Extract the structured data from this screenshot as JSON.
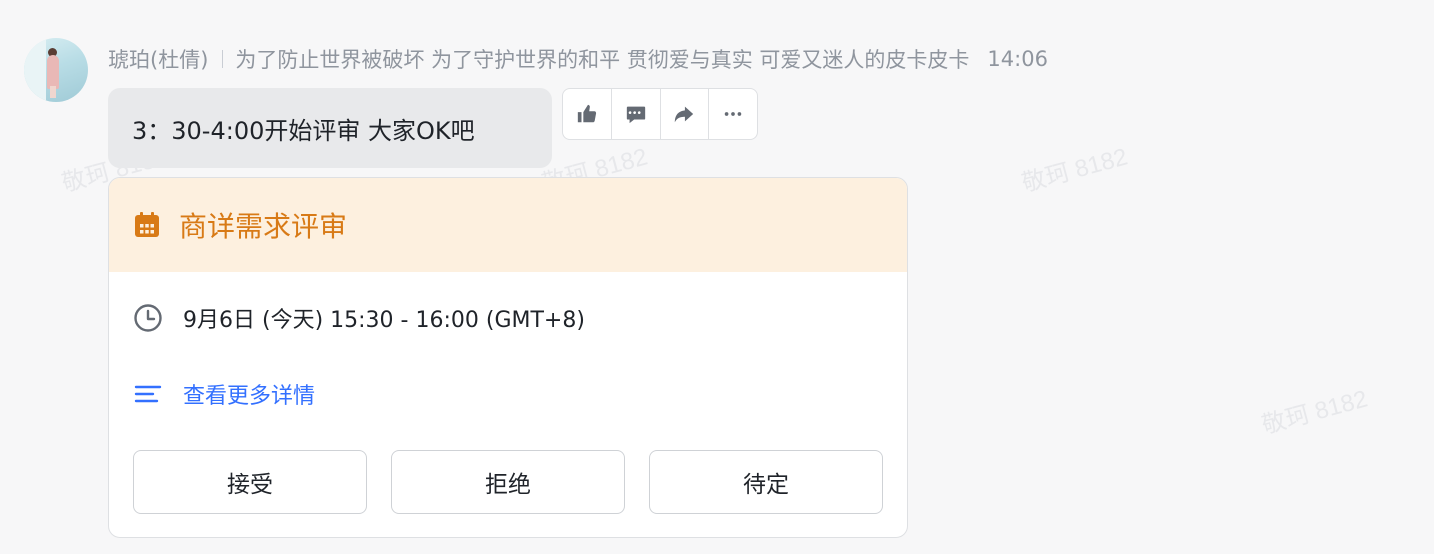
{
  "message": {
    "sender": "琥珀(杜倩)",
    "signature": "为了防止世界被破坏 为了守护世界的和平 贯彻爱与真实 可爱又迷人的皮卡皮卡",
    "time": "14:06",
    "text": "3：30-4:00开始评审 大家OK吧"
  },
  "toolbar": {
    "icons": [
      "thumbs-up-icon",
      "reply-comment-icon",
      "forward-icon",
      "more-icon"
    ]
  },
  "event_card": {
    "title": "商详需求评审",
    "time_text": "9月6日 (今天) 15:30 - 16:00 (GMT+8)",
    "details_link": "查看更多详情",
    "accent_color": "#d87a16",
    "header_bg": "#fdf0df",
    "link_color": "#3370ff",
    "buttons": {
      "accept": "接受",
      "decline": "拒绝",
      "tentative": "待定"
    }
  },
  "watermark": {
    "text": "敬珂 8182"
  }
}
